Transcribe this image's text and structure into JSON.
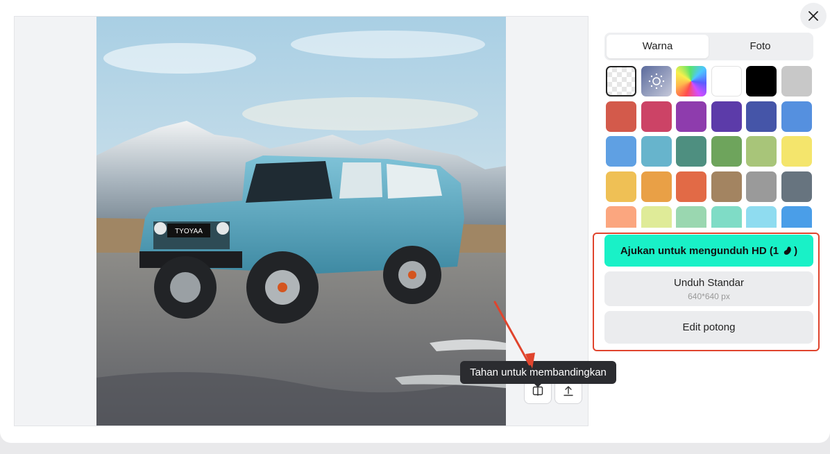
{
  "tabs": [
    {
      "label": "Warna",
      "active": true
    },
    {
      "label": "Foto",
      "active": false
    }
  ],
  "swatches": [
    "transparent",
    "blur",
    "rainbow",
    "#ffffff",
    "#000000",
    "#c8c8c8",
    "#d35a4b",
    "#cc4366",
    "#8e3cad",
    "#5c3ba9",
    "#4555a8",
    "#5590df",
    "#5fa0e3",
    "#67b4cc",
    "#4e8f80",
    "#6ea45c",
    "#a8c579",
    "#f4e56c",
    "#efc055",
    "#e9a046",
    "#e26a46",
    "#a38461",
    "#9a9a9a",
    "#67747f",
    "#fba67f",
    "#dfeb98",
    "#9ad7b0",
    "#7fdcc6",
    "#8fdcf0",
    "#4a9ee8"
  ],
  "actions": {
    "hd_label": "Ajukan untuk mengunduh HD (1",
    "hd_icon": "bean-credit-icon",
    "hd_suffix": ")",
    "standard_label": "Unduh Standar",
    "standard_size": "640*640 px",
    "crop_label": "Edit potong"
  },
  "tooltip": "Tahan untuk membandingkan",
  "photo": {
    "plate": "TYOYAA"
  },
  "colors": {
    "accent": "#19f1c7",
    "annotation": "#e0442d"
  }
}
